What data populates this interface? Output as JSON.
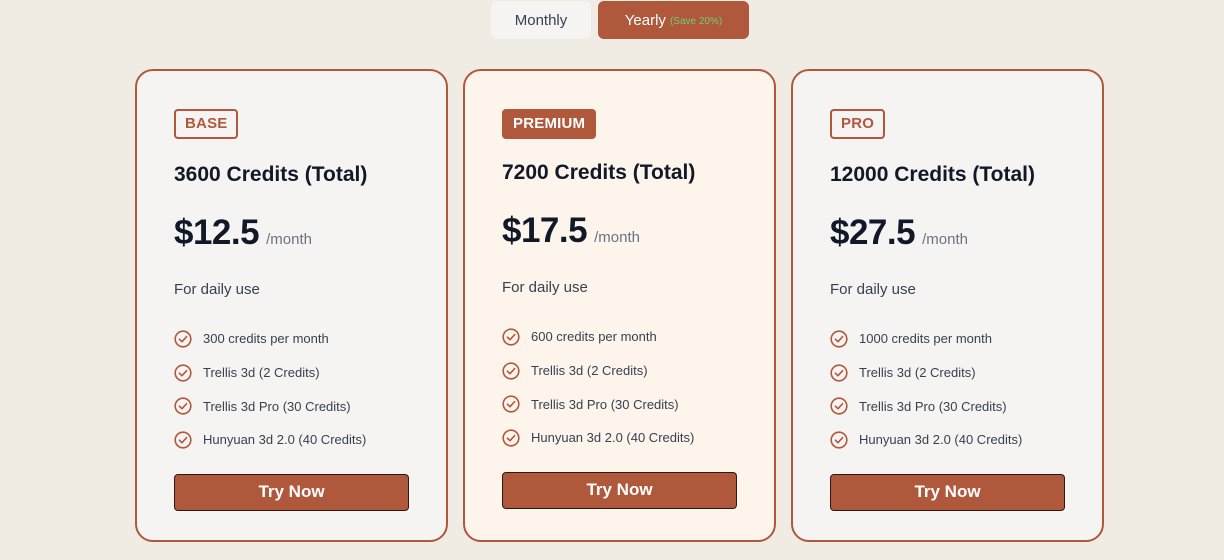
{
  "billing_toggle": {
    "monthly_label": "Monthly",
    "yearly_label": "Yearly",
    "yearly_discount": "(Save 20%)",
    "selected": "yearly"
  },
  "colors": {
    "accent": "#b0583c",
    "page_background": "#f0ece4",
    "card_background": "#f6f4f2",
    "highlight_card_background": "#fdf4ec",
    "discount_text": "#6fd16f"
  },
  "plans": [
    {
      "badge": "BASE",
      "credits_title": "3600 Credits (Total)",
      "price": "$12.5",
      "period": "/month",
      "tagline": "For daily use",
      "features": [
        "300 credits per month",
        "Trellis 3d (2 Credits)",
        "Trellis 3d Pro (30 Credits)",
        "Hunyuan 3d 2.0 (40 Credits)"
      ],
      "cta_label": "Try Now"
    },
    {
      "badge": "PREMIUM",
      "credits_title": "7200 Credits (Total)",
      "price": "$17.5",
      "period": "/month",
      "tagline": "For daily use",
      "features": [
        "600 credits per month",
        "Trellis 3d (2 Credits)",
        "Trellis 3d Pro (30 Credits)",
        "Hunyuan 3d 2.0 (40 Credits)"
      ],
      "cta_label": "Try Now"
    },
    {
      "badge": "PRO",
      "credits_title": "12000 Credits (Total)",
      "price": "$27.5",
      "period": "/month",
      "tagline": "For daily use",
      "features": [
        "1000 credits per month",
        "Trellis 3d (2 Credits)",
        "Trellis 3d Pro (30 Credits)",
        "Hunyuan 3d 2.0 (40 Credits)"
      ],
      "cta_label": "Try Now"
    }
  ]
}
